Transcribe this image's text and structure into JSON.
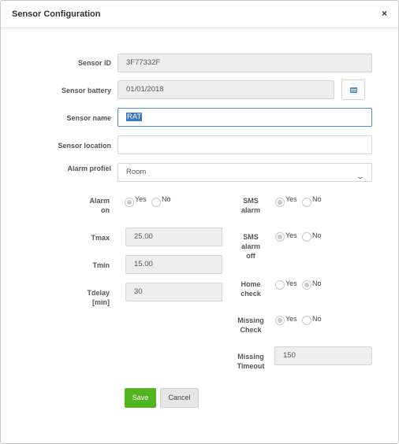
{
  "dialog": {
    "title": "Sensor Configuration",
    "close": "×"
  },
  "form": {
    "sensor_id": {
      "label": "Sensor ID",
      "value": "3F77332F"
    },
    "sensor_battery": {
      "label": "Sensor battery",
      "value": "01/01/2018",
      "icon": "calendar-icon"
    },
    "sensor_name": {
      "label": "Sensor name",
      "value": "RAT"
    },
    "sensor_location": {
      "label": "Sensor location",
      "value": ""
    },
    "alarm_profile": {
      "label": "Alarm profiel",
      "value": "Room",
      "icon": "chevron-down-icon"
    }
  },
  "left": {
    "alarm_on": {
      "label_1": "Alarm",
      "label_2": "on",
      "yes": "Yes",
      "no": "No",
      "selected": "Yes"
    },
    "tmax": {
      "label": "Tmax",
      "value": "25.00"
    },
    "tmin": {
      "label": "Tmin",
      "value": "15.00"
    },
    "tdelay": {
      "label_1": "Tdelay",
      "label_2": "[min]",
      "value": "30"
    }
  },
  "right": {
    "sms_alarm": {
      "label_1": "SMS",
      "label_2": "alarm",
      "yes": "Yes",
      "no": "No",
      "selected": "Yes"
    },
    "sms_alarm_off": {
      "label_1": "SMS",
      "label_2": "alarm",
      "label_3": "off",
      "yes": "Yes",
      "no": "No",
      "selected": "Yes"
    },
    "home_check": {
      "label_1": "Home",
      "label_2": "check",
      "yes": "Yes",
      "no": "No",
      "selected": "No"
    },
    "missing_check": {
      "label_1": "Missing",
      "label_2": "Check",
      "yes": "Yes",
      "no": "No",
      "selected": "Yes"
    },
    "missing_timeout": {
      "label_1": "Missing",
      "label_2": "Timeout",
      "value": "150"
    }
  },
  "actions": {
    "save": "Save",
    "cancel": "Cancel"
  },
  "colors": {
    "save": "#52b51f",
    "focus_border": "#4a90c8",
    "selection": "#3a78c3"
  }
}
